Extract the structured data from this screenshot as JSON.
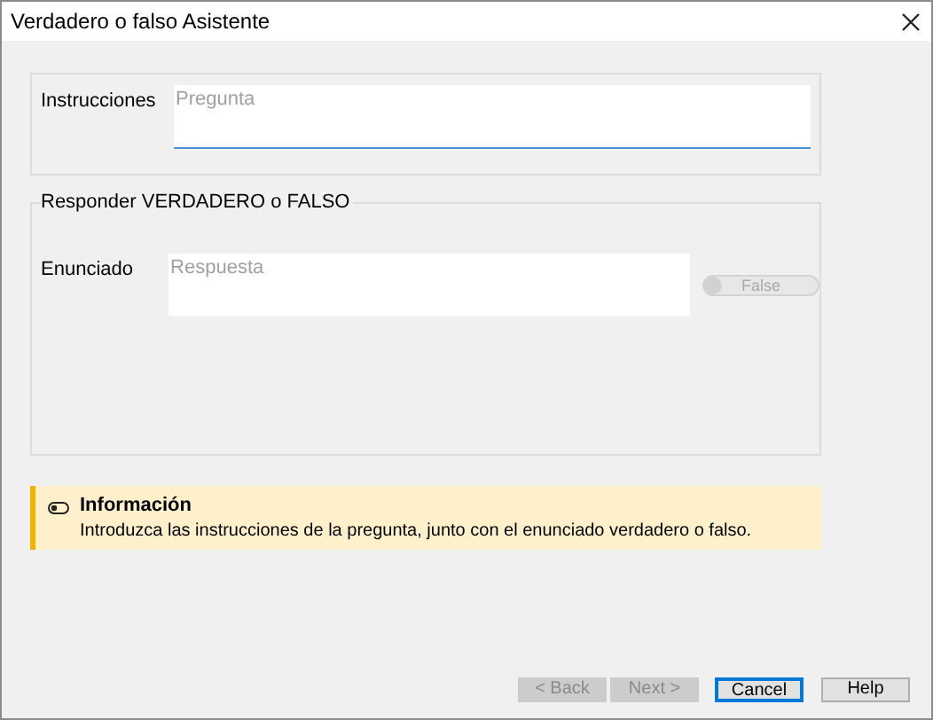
{
  "window": {
    "title": "Verdadero o falso Asistente"
  },
  "instructions": {
    "label": "Instrucciones",
    "placeholder": "Pregunta"
  },
  "answer_group": {
    "title": "Responder VERDADERO o FALSO",
    "label": "Enunciado",
    "placeholder": "Respuesta",
    "toggle": {
      "label": "False",
      "on": false,
      "disabled": true
    }
  },
  "info": {
    "title": "Información",
    "message": "Introduzca las instrucciones de la pregunta, junto con el enunciado verdadero o falso."
  },
  "buttons": [
    {
      "label": "< Back",
      "disabled": true,
      "default": false
    },
    {
      "label": "Next >",
      "disabled": true,
      "default": false
    },
    {
      "label": "Cancel",
      "disabled": false,
      "default": true
    },
    {
      "label": "Help",
      "disabled": false,
      "default": false
    }
  ]
}
